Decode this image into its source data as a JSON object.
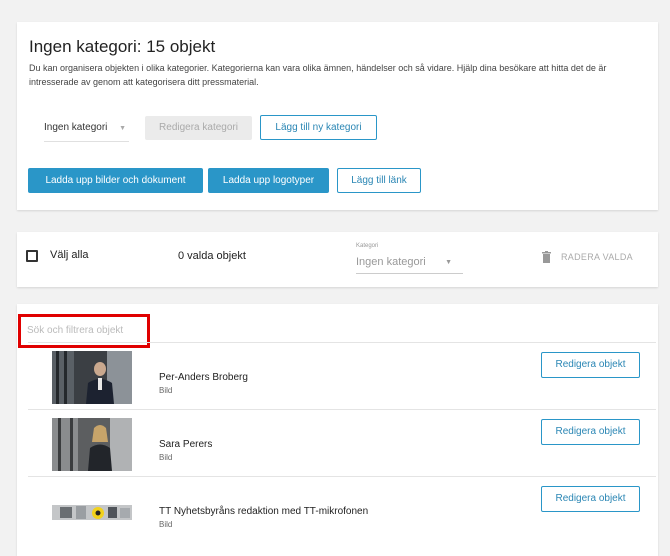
{
  "category_card": {
    "title": "Ingen kategori: 15 objekt",
    "description": "Du kan organisera objekten i olika kategorier. Kategorierna kan vara olika ämnen, händelser och så vidare. Hjälp dina besökare att hitta det de är intresserade av genom att kategorisera ditt pressmaterial.",
    "category_select": "Ingen kategori",
    "edit_category_label": "Redigera kategori",
    "add_category_label": "Lägg till ny kategori",
    "upload_label": "Ladda upp bilder och dokument",
    "upload_logo_label": "Ladda upp logotyper",
    "add_link_label": "Lägg till länk"
  },
  "bulk_bar": {
    "select_all_label": "Välj alla",
    "selected_count": "0 valda objekt",
    "category_field_label": "Kategori",
    "category_field_value": "Ingen kategori",
    "delete_label": "RADERA VALDA"
  },
  "list": {
    "search_placeholder": "Sök och filtrera objekt",
    "edit_label": "Redigera objekt",
    "items": [
      {
        "name": "Per-Anders Broberg",
        "type": "Bild"
      },
      {
        "name": "Sara Perers",
        "type": "Bild"
      },
      {
        "name": "TT Nyhetsbyråns redaktion med TT-mikrofonen",
        "type": "Bild"
      }
    ]
  },
  "colors": {
    "accent": "#2a96c8",
    "highlight": "#e00000",
    "background": "#f2f2f2"
  }
}
